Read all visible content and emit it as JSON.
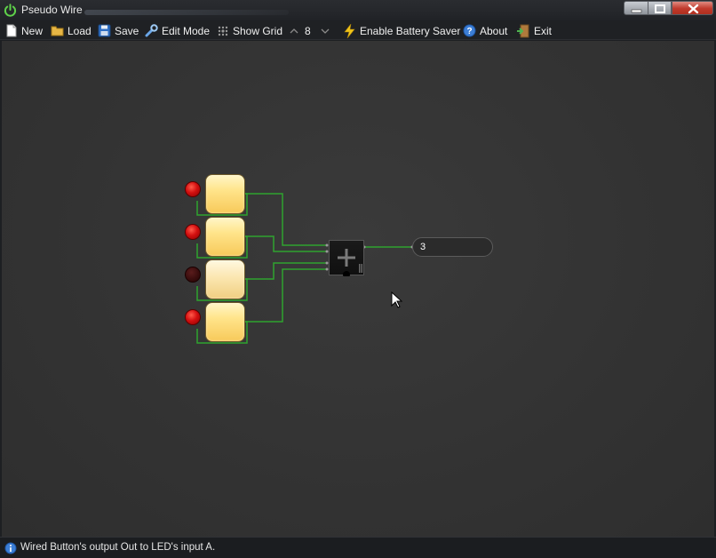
{
  "window": {
    "title": "Pseudo Wire"
  },
  "toolbar": {
    "new_label": "New",
    "load_label": "Load",
    "save_label": "Save",
    "edit_mode_label": "Edit Mode",
    "show_grid_label": "Show Grid",
    "grid_size_value": "8",
    "battery_saver_label": "Enable Battery Saver",
    "about_label": "About",
    "exit_label": "Exit"
  },
  "canvas": {
    "components": [
      {
        "type": "led",
        "state": "on"
      },
      {
        "type": "led",
        "state": "on"
      },
      {
        "type": "led",
        "state": "off"
      },
      {
        "type": "led",
        "state": "on"
      },
      {
        "type": "push-button"
      },
      {
        "type": "push-button"
      },
      {
        "type": "push-button"
      },
      {
        "type": "push-button"
      },
      {
        "type": "adder"
      }
    ],
    "display_value": "3"
  },
  "status": {
    "message": "Wired Button's output Out to LED's input A."
  },
  "colors": {
    "wire": "#2fa32f",
    "led_on": "#d41010",
    "led_off": "#3a0d0d",
    "button_fill": "#ffe48a",
    "canvas_bg": "#333333"
  }
}
